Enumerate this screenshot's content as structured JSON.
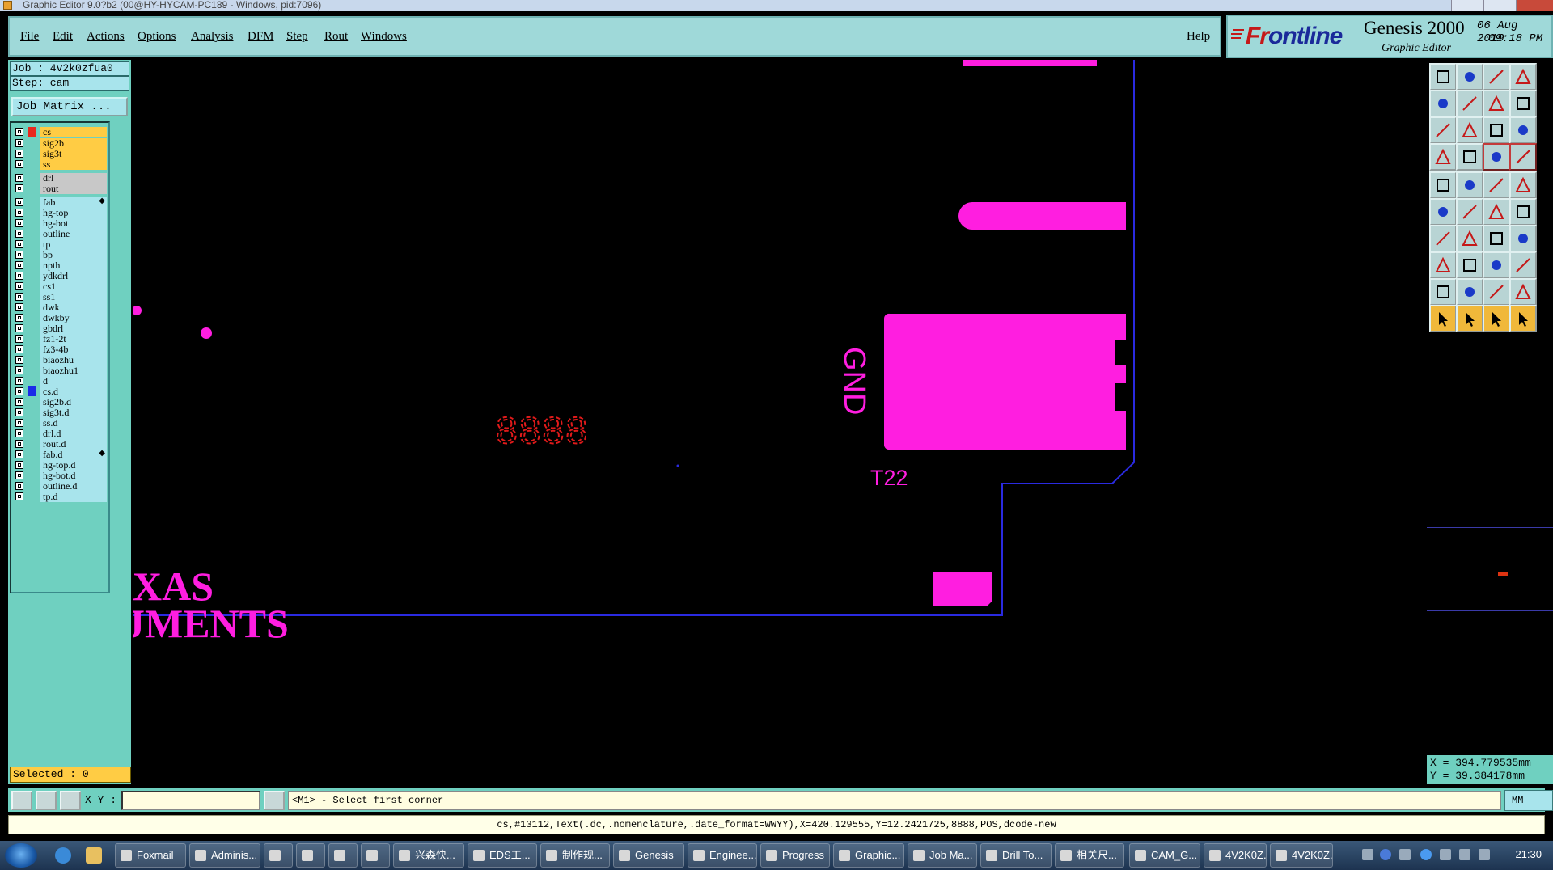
{
  "window": {
    "title": "Graphic Editor 9.0?b2 (00@HY-HYCAM-PC189 - Windows, pid:7096)"
  },
  "menu": {
    "items": [
      "File",
      "Edit",
      "Actions",
      "Options",
      "Analysis",
      "DFM",
      "Step",
      "Rout",
      "Windows"
    ],
    "help": "Help"
  },
  "brand": {
    "logo_first": "Fr",
    "logo_o": "o",
    "logo_rest": "ntline",
    "product": "Genesis 2000",
    "subtitle": "Graphic Editor",
    "date": "06 Aug 2019",
    "time": "09:18 PM"
  },
  "job": {
    "job_label": "Job : 4v2k0zfua0",
    "step_label": "Step: cam",
    "job_matrix_button": "Job Matrix ..."
  },
  "layers": [
    {
      "name": "cs",
      "kind": "board",
      "swatch": "#e8281e"
    },
    {
      "name": "sig2b",
      "kind": "board",
      "swatch": ""
    },
    {
      "name": "sig3t",
      "kind": "board",
      "swatch": ""
    },
    {
      "name": "ss",
      "kind": "board",
      "swatch": ""
    },
    {
      "name": "drl",
      "kind": "drill",
      "swatch": ""
    },
    {
      "name": "rout",
      "kind": "drill",
      "swatch": ""
    },
    {
      "name": "fab",
      "kind": "misc",
      "swatch": ""
    },
    {
      "name": "hg-top",
      "kind": "misc",
      "swatch": ""
    },
    {
      "name": "hg-bot",
      "kind": "misc",
      "swatch": ""
    },
    {
      "name": "outline",
      "kind": "misc",
      "swatch": ""
    },
    {
      "name": "tp",
      "kind": "misc",
      "swatch": ""
    },
    {
      "name": "bp",
      "kind": "misc",
      "swatch": ""
    },
    {
      "name": "npth",
      "kind": "misc",
      "swatch": ""
    },
    {
      "name": "ydkdrl",
      "kind": "misc",
      "swatch": ""
    },
    {
      "name": "cs1",
      "kind": "misc",
      "swatch": ""
    },
    {
      "name": "ss1",
      "kind": "misc",
      "swatch": ""
    },
    {
      "name": "dwk",
      "kind": "misc",
      "swatch": ""
    },
    {
      "name": "dwkby",
      "kind": "misc",
      "swatch": ""
    },
    {
      "name": "gbdrl",
      "kind": "misc",
      "swatch": ""
    },
    {
      "name": "fz1-2t",
      "kind": "misc",
      "swatch": ""
    },
    {
      "name": "fz3-4b",
      "kind": "misc",
      "swatch": ""
    },
    {
      "name": "biaozhu",
      "kind": "misc",
      "swatch": ""
    },
    {
      "name": "biaozhu1",
      "kind": "misc",
      "swatch": ""
    },
    {
      "name": "d",
      "kind": "misc",
      "swatch": ""
    },
    {
      "name": "cs.d",
      "kind": "misc",
      "swatch": "#1a2ae8"
    },
    {
      "name": "sig2b.d",
      "kind": "misc",
      "swatch": ""
    },
    {
      "name": "sig3t.d",
      "kind": "misc",
      "swatch": ""
    },
    {
      "name": "ss.d",
      "kind": "misc",
      "swatch": ""
    },
    {
      "name": "drl.d",
      "kind": "misc",
      "swatch": ""
    },
    {
      "name": "rout.d",
      "kind": "misc",
      "swatch": ""
    },
    {
      "name": "fab.d",
      "kind": "misc",
      "swatch": ""
    },
    {
      "name": "hg-top.d",
      "kind": "misc",
      "swatch": ""
    },
    {
      "name": "hg-bot.d",
      "kind": "misc",
      "swatch": ""
    },
    {
      "name": "outline.d",
      "kind": "misc",
      "swatch": ""
    },
    {
      "name": "tp.d",
      "kind": "misc",
      "swatch": ""
    }
  ],
  "selected": "Selected : 0",
  "canvas": {
    "text_gnd": "GND",
    "text_t22": "T22",
    "text_8888": "8888",
    "text_xas": "XAS",
    "text_uments": "JMENTS",
    "colors": {
      "copper": "#ff1ee0",
      "profile": "#2a2ae0",
      "datecode": "#e01a1a"
    }
  },
  "coords": {
    "x": "X = 394.779535mm",
    "y": "Y = 39.384178mm"
  },
  "cmd": {
    "xy_label": "X Y :",
    "xy_value": "",
    "prompt": "<M1> - Select first corner",
    "units": "MM"
  },
  "status": "cs,#13112,Text(.dc,.nomenclature,.date_format=WWYY),X=420.129555,Y=12.2421725,8888,POS,dcode-new",
  "taskbar": {
    "tasks": [
      "Foxmail",
      "Adminis...",
      "",
      "",
      "",
      "",
      "兴森快...",
      "EDS工...",
      "制作规...",
      "Genesis",
      "Enginee...",
      "Progress",
      "Graphic...",
      "Job Ma...",
      "Drill To...",
      "相关尺...",
      "CAM_G...",
      "4V2K0Z...",
      "4V2K0Z..."
    ],
    "clock": "21:30"
  },
  "icons": [
    "windows-start-icon",
    "ie-icon",
    "folder-icon"
  ]
}
